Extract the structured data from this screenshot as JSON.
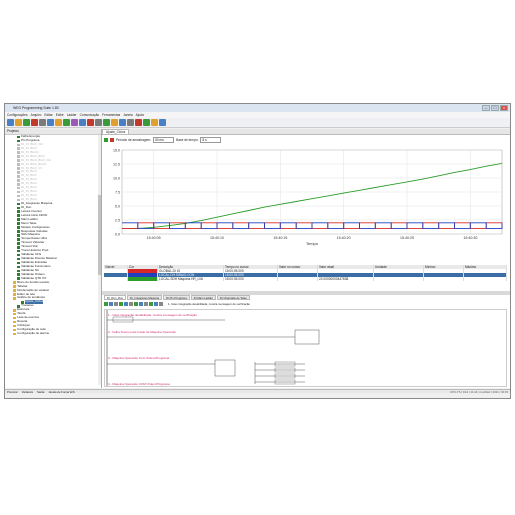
{
  "window": {
    "title": "WEG Programming Suite 1.80"
  },
  "menu": [
    "Configurações",
    "Arquivo",
    "Editar",
    "Exibir",
    "Ladder",
    "Comunicação",
    "Ferramentas",
    "Janela",
    "Ajuda"
  ],
  "left_panel": {
    "header": "Projetos",
    "items": [
      {
        "label": "Falha Energia",
        "state": "normal"
      },
      {
        "label": "Pin Programa",
        "state": "normal"
      },
      {
        "label": "DI_DI_BGX_JUI",
        "state": "grey"
      },
      {
        "label": "DI_DI_BGX",
        "state": "grey"
      },
      {
        "label": "DI_DI_BGX2",
        "state": "grey"
      },
      {
        "label": "DI_DI_BGX_BGX",
        "state": "grey"
      },
      {
        "label": "DI_DI_BGX_BGX_GG",
        "state": "grey"
      },
      {
        "label": "DI_DI_BGX_BGX2",
        "state": "grey"
      },
      {
        "label": "DI_DI_BGX_V1",
        "state": "grey"
      },
      {
        "label": "DI_DI_BGX",
        "state": "grey"
      },
      {
        "label": "DI_DI_BGX",
        "state": "grey"
      },
      {
        "label": "DI_DI_BGX",
        "state": "grey"
      },
      {
        "label": "DI_DI_BGX",
        "state": "grey"
      },
      {
        "label": "DI_DI_BGX",
        "state": "grey"
      },
      {
        "label": "DI_DI_BGX",
        "state": "grey"
      },
      {
        "label": "DI_DI_BGX",
        "state": "grey"
      },
      {
        "label": "DI_DI_BGX",
        "state": "grey"
      },
      {
        "label": "DI_Integracao Maquina",
        "state": "normal"
      },
      {
        "label": "DI_Run",
        "state": "normal"
      },
      {
        "label": "Leitura Inversor",
        "state": "normal"
      },
      {
        "label": "Leitura Inicio ADCD",
        "state": "normal"
      },
      {
        "label": "Main Ladder",
        "state": "normal"
      },
      {
        "label": "Menu Telas",
        "state": "normal"
      },
      {
        "label": "Modelo Configuracao",
        "state": "normal"
      },
      {
        "label": "Respostas Válvulas",
        "state": "normal"
      },
      {
        "label": "SDH Maquina",
        "state": "normal"
      },
      {
        "label": "Temporizacao Ultra",
        "state": "normal"
      },
      {
        "label": "Timeout Válvulas",
        "state": "normal"
      },
      {
        "label": "Timeout Run",
        "state": "normal"
      },
      {
        "label": "Troca Histórico Prod",
        "state": "normal"
      },
      {
        "label": "Validacao CFG",
        "state": "normal"
      },
      {
        "label": "Validacao Diverso Material",
        "state": "normal"
      },
      {
        "label": "Validacao Entradas",
        "state": "normal"
      },
      {
        "label": "Validacao Funcionario",
        "state": "normal"
      },
      {
        "label": "Validacao NC",
        "state": "normal"
      },
      {
        "label": "Validacao Ordens",
        "state": "normal"
      },
      {
        "label": "Validacao QTD OX",
        "state": "normal"
      },
      {
        "label": "Bloco de funcão usuário",
        "state": "folder"
      },
      {
        "label": "Tabelas",
        "state": "folder"
      },
      {
        "label": "Monitoração de variável",
        "state": "folder"
      },
      {
        "label": "Editor de tela",
        "state": "folder"
      },
      {
        "label": "Gráfico de tendência",
        "state": "folder"
      },
      {
        "label": "Ajuste_Ciclos",
        "state": "sel"
      },
      {
        "label": "Trocacao",
        "state": "normal"
      },
      {
        "label": "Estrutura",
        "state": "folder"
      },
      {
        "label": "Tarefa",
        "state": "folder"
      },
      {
        "label": "Lista de eventos",
        "state": "folder"
      },
      {
        "label": "Receita",
        "state": "folder"
      },
      {
        "label": "CANopen",
        "state": "folder"
      },
      {
        "label": "Configuração de rede",
        "state": "folder"
      },
      {
        "label": "Configuração de alarme",
        "state": "folder"
      }
    ]
  },
  "doc_tab": "Ajuste_Ciclos",
  "controls": {
    "period_label": "Período de amostragem:",
    "period_value": "50 ms",
    "base_label": "Base de tempo:",
    "base_value": "8 s"
  },
  "chart_data": {
    "type": "line",
    "xlabel": "Tempo",
    "x": [
      "15:40:05",
      "15:40:10",
      "15:40:15",
      "15:40:20",
      "15:40:25",
      "15:40:30"
    ],
    "ylim": [
      0,
      15
    ],
    "yticks": [
      "0.0",
      "2.5",
      "5.0",
      "7.5",
      "10.0",
      "12.5",
      "15.0"
    ],
    "grid": true,
    "series": [
      {
        "color": "#2a9d2a",
        "values": [
          1,
          1,
          1.2,
          1.5,
          1.9,
          2.4,
          3.0,
          3.6,
          4.2,
          4.8,
          5.3,
          5.8,
          6.3,
          6.8,
          7.3,
          7.8,
          8.3,
          8.8,
          9.3,
          9.8,
          10.4,
          11.0,
          11.5,
          12.1,
          12.6
        ]
      },
      {
        "color": "#d62728",
        "values": [
          1,
          2,
          1,
          2,
          1,
          2,
          1,
          2,
          1,
          2,
          1,
          2,
          1,
          2,
          1,
          2,
          1,
          2,
          1,
          2,
          1,
          2,
          1,
          2,
          1
        ]
      },
      {
        "color": "#1f3fbf",
        "values": [
          2,
          1,
          2,
          1,
          2,
          1,
          2,
          1,
          2,
          1,
          2,
          1,
          2,
          1,
          2,
          1,
          2,
          1,
          2,
          1,
          2,
          1,
          2,
          1,
          2
        ]
      }
    ]
  },
  "table": {
    "headers": [
      "Visível",
      "Cor",
      "Descrição",
      "Tempo no cursor",
      "Valor no cursor",
      "Valor atual",
      "Unidade",
      "Mínimo",
      "Máximo"
    ],
    "rows": [
      {
        "cells": [
          "",
          "",
          "GLOBAL.DI IO",
          "15:00:05.000",
          "",
          "",
          "",
          "",
          ""
        ],
        "color": "#d62728",
        "selected": false
      },
      {
        "cells": [
          "",
          "",
          "LOCAL.DH.SWAIO.CON",
          "15:00:05.000",
          "",
          "",
          "",
          "",
          ""
        ],
        "color": "#1f3fbf",
        "selected": true
      },
      {
        "cells": [
          "",
          "",
          "LOCAL.SDH Maquina.HR_LVA",
          "15:00:05.000",
          "",
          "22.00000000447838",
          "",
          "",
          ""
        ],
        "color": "#2a9d2a",
        "selected": false
      }
    ]
  },
  "bottom_tabs": [
    "DI_Run_Run",
    "Di_Integracao Maquina",
    "DI Pin Programa",
    "DI Main Ladder",
    "DI Chamada de Telas"
  ],
  "ladder": {
    "info": "1. Caso integração desabilitada, mostra mensagem de verificação",
    "rungs": [
      "1 - Caso integração desabilitada, mostra mensagem de verificação",
      "2 - Falha Tempo para Iniciar de Maquina Operando",
      "3 - Maquina Operando Com Ordem/Programa",
      "4 - Maquina Operando COM Ordem/Programa"
    ]
  },
  "status_bar": {
    "items": [
      "Procurar",
      "Variáveis",
      "Saída",
      "Janela de Forçar E/S"
    ],
    "right": "CPU-TS | DA1 | 11:44 | modified | 2021 | 00:03"
  }
}
